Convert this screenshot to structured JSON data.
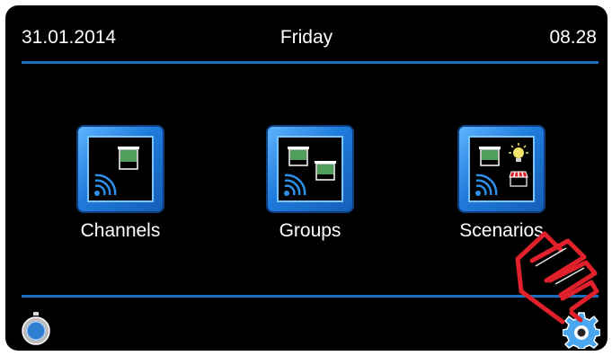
{
  "header": {
    "date": "31.01.2014",
    "day": "Friday",
    "time": "08.28"
  },
  "menu": {
    "items": [
      {
        "label": "Channels",
        "icon": "channels-icon"
      },
      {
        "label": "Groups",
        "icon": "groups-icon"
      },
      {
        "label": "Scenarios",
        "icon": "scenarios-icon"
      }
    ]
  },
  "footer": {
    "left_icon": "timer-icon",
    "right_icon": "settings-gear-icon"
  },
  "colors": {
    "background": "#000000",
    "accent_line": "#1a6fc0",
    "tile_blue": "#1f7bdc",
    "shade_green": "#4f9f5a",
    "pointer_red": "#e0202a"
  }
}
